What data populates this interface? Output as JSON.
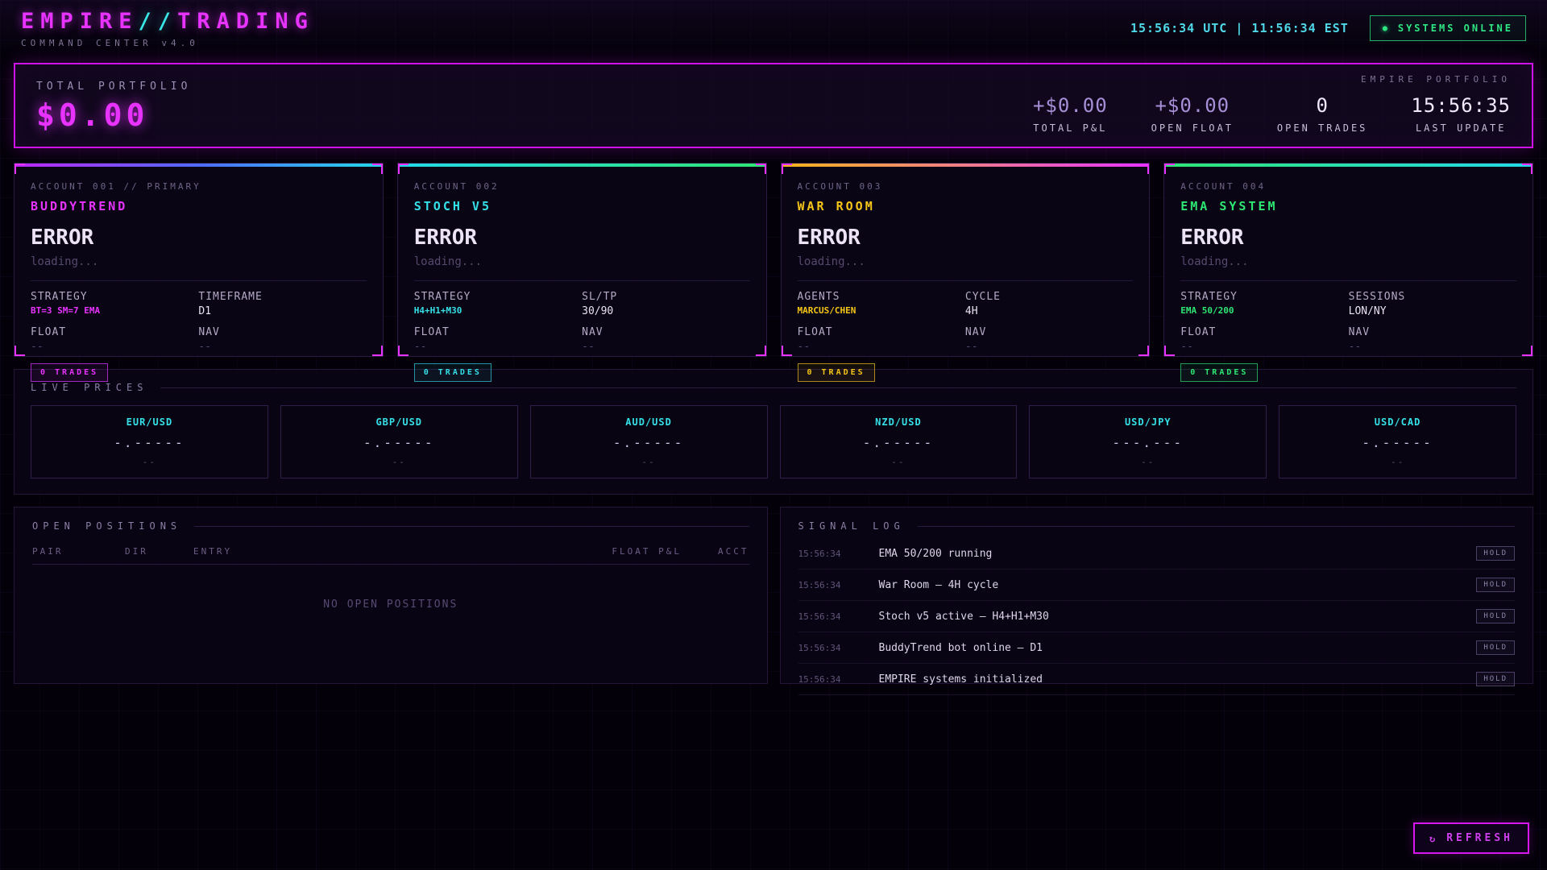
{
  "theme": {
    "magenta": "#e833ff",
    "cyan": "#35e0e8",
    "yellow": "#f5c518",
    "green": "#2ee673",
    "lavender": "#a78fd8",
    "background": "#030009"
  },
  "header": {
    "title_left": "EMPIRE",
    "title_sep": "//",
    "title_right": "TRADING",
    "subtitle": "COMMAND CENTER v4.0",
    "clock": "15:56:34 UTC | 11:56:34 EST",
    "status_dot": "●",
    "status_label": "SYSTEMS ONLINE"
  },
  "portfolio": {
    "label": "TOTAL PORTFOLIO",
    "value": "$0.00",
    "tag": "EMPIRE PORTFOLIO",
    "stats": [
      {
        "value": "+$0.00",
        "label": "TOTAL P&L"
      },
      {
        "value": "+$0.00",
        "label": "OPEN FLOAT"
      },
      {
        "value": "0",
        "label": "OPEN TRADES"
      },
      {
        "value": "15:56:35",
        "label": "LAST UPDATE"
      }
    ]
  },
  "accounts": [
    {
      "id": "ACCOUNT 001 // PRIMARY",
      "name": "BUDDYTREND",
      "status": "ERROR",
      "note": "loading...",
      "fields": [
        {
          "label": "STRATEGY",
          "value": "BT=3 SM=7 EMA"
        },
        {
          "label": "TIMEFRAME",
          "value": "D1"
        },
        {
          "label": "FLOAT",
          "value": "--"
        },
        {
          "label": "NAV",
          "value": "--"
        }
      ],
      "badge": "0 TRADES"
    },
    {
      "id": "ACCOUNT 002",
      "name": "STOCH V5",
      "status": "ERROR",
      "note": "loading...",
      "fields": [
        {
          "label": "STRATEGY",
          "value": "H4+H1+M30"
        },
        {
          "label": "SL/TP",
          "value": "30/90"
        },
        {
          "label": "FLOAT",
          "value": "--"
        },
        {
          "label": "NAV",
          "value": "--"
        }
      ],
      "badge": "0 TRADES"
    },
    {
      "id": "ACCOUNT 003",
      "name": "WAR ROOM",
      "status": "ERROR",
      "note": "loading...",
      "fields": [
        {
          "label": "AGENTS",
          "value": "MARCUS/CHEN"
        },
        {
          "label": "CYCLE",
          "value": "4H"
        },
        {
          "label": "FLOAT",
          "value": "--"
        },
        {
          "label": "NAV",
          "value": "--"
        }
      ],
      "badge": "0 TRADES"
    },
    {
      "id": "ACCOUNT 004",
      "name": "EMA SYSTEM",
      "status": "ERROR",
      "note": "loading...",
      "fields": [
        {
          "label": "STRATEGY",
          "value": "EMA 50/200"
        },
        {
          "label": "SESSIONS",
          "value": "LON/NY"
        },
        {
          "label": "FLOAT",
          "value": "--"
        },
        {
          "label": "NAV",
          "value": "--"
        }
      ],
      "badge": "0 TRADES"
    }
  ],
  "prices": {
    "title": "LIVE PRICES",
    "tiles": [
      {
        "symbol": "EUR/USD",
        "price": "-.-----",
        "change": "--"
      },
      {
        "symbol": "GBP/USD",
        "price": "-.-----",
        "change": "--"
      },
      {
        "symbol": "AUD/USD",
        "price": "-.-----",
        "change": "--"
      },
      {
        "symbol": "NZD/USD",
        "price": "-.-----",
        "change": "--"
      },
      {
        "symbol": "USD/JPY",
        "price": "---.---",
        "change": "--"
      },
      {
        "symbol": "USD/CAD",
        "price": "-.-----",
        "change": "--"
      }
    ]
  },
  "positions": {
    "title": "OPEN POSITIONS",
    "columns": [
      "PAIR",
      "DIR",
      "ENTRY",
      "FLOAT P&L",
      "ACCT"
    ],
    "empty": "NO OPEN POSITIONS"
  },
  "signals": {
    "title": "SIGNAL LOG",
    "rows": [
      {
        "time": "15:56:34",
        "message": "EMA 50/200 running",
        "action": "HOLD"
      },
      {
        "time": "15:56:34",
        "message": "War Room — 4H cycle",
        "action": "HOLD"
      },
      {
        "time": "15:56:34",
        "message": "Stoch v5 active — H4+H1+M30",
        "action": "HOLD"
      },
      {
        "time": "15:56:34",
        "message": "BuddyTrend bot online — D1",
        "action": "HOLD"
      },
      {
        "time": "15:56:34",
        "message": "EMPIRE systems initialized",
        "action": "HOLD"
      }
    ]
  },
  "refresh": {
    "icon": "↻",
    "label": "REFRESH"
  }
}
